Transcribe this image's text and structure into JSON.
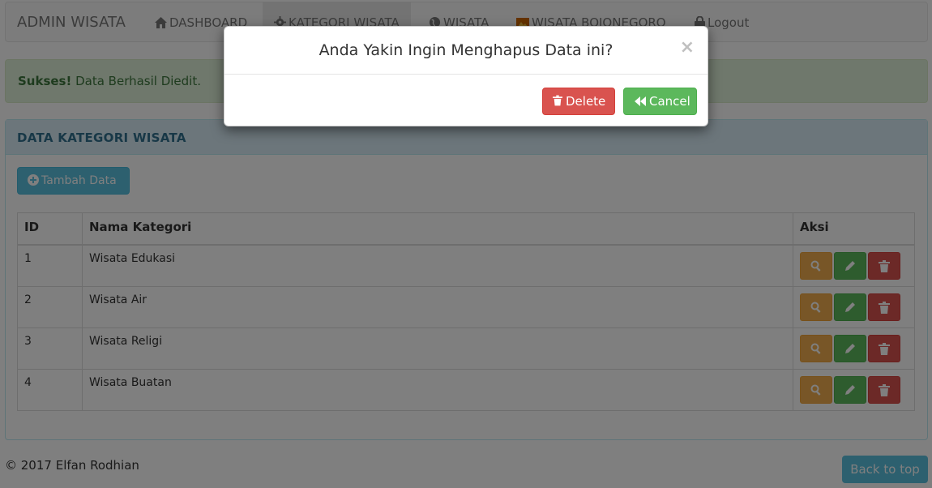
{
  "navbar": {
    "brand": "ADMIN WISATA",
    "items": [
      {
        "label": "DASHBOARD",
        "icon": "home-icon"
      },
      {
        "label": "KATEGORI WISATA",
        "icon": "gear-icon",
        "active": true
      },
      {
        "label": "WISATA",
        "icon": "globe-icon"
      },
      {
        "label": "WISATA BOJONEGORO",
        "icon": "image-icon"
      },
      {
        "label": "Logout",
        "icon": "lock-icon"
      }
    ]
  },
  "alert": {
    "strong": "Sukses!",
    "text": " Data Berhasil Diedit."
  },
  "panel": {
    "title": "DATA KATEGORI WISATA",
    "add_button": "Tambah Data",
    "columns": [
      "ID",
      "Nama Kategori",
      "Aksi"
    ],
    "rows": [
      {
        "id": "1",
        "name": "Wisata Edukasi"
      },
      {
        "id": "2",
        "name": "Wisata Air"
      },
      {
        "id": "3",
        "name": "Wisata Religi"
      },
      {
        "id": "4",
        "name": "Wisata Buatan"
      }
    ]
  },
  "footer": {
    "copyright": "© 2017 Elfan Rodhian",
    "back_to_top": "Back to top"
  },
  "modal": {
    "title": "Anda Yakin Ingin Menghapus Data ini?",
    "close": "×",
    "delete_label": "Delete",
    "cancel_label": "Cancel"
  },
  "colors": {
    "info": "#5bc0de",
    "warning": "#f0ad4e",
    "success": "#5cb85c",
    "danger": "#d9534f",
    "alert_bg": "#dff0d8",
    "panel_heading_bg": "#d9edf7"
  }
}
